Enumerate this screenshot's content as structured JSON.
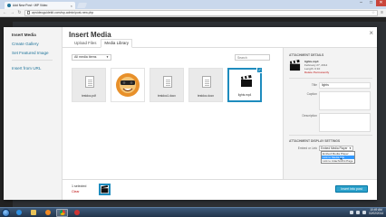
{
  "browser": {
    "tab_title": "Add New Post ‹ WP Video",
    "url": "wpvideoguidekit.com/wp-admin/post-new.php",
    "new_tab_label": "",
    "window_controls": [
      "–",
      "□",
      "✕"
    ]
  },
  "modal": {
    "title": "Insert Media",
    "close_label": "×",
    "menu": {
      "active": "Insert Media",
      "items": [
        "Create Gallery",
        "Set Featured Image"
      ],
      "url_item": "Insert from URL"
    },
    "router": {
      "tabs": [
        "Upload Files",
        "Media Library"
      ],
      "active_index": 1
    },
    "filter": {
      "selected": "All media items",
      "search_placeholder": "Search"
    },
    "attachments": [
      {
        "filename": "testdoc.pdf",
        "type": "document"
      },
      {
        "filename": "",
        "type": "image"
      },
      {
        "filename": "testdoc1.docx",
        "type": "document"
      },
      {
        "filename": "testdoc.docx",
        "type": "document"
      },
      {
        "filename": "lights.mp4",
        "type": "video",
        "selected": true
      }
    ],
    "details": {
      "heading": "ATTACHMENT DETAILS",
      "filename": "lights.mp4",
      "date": "February 27, 2014",
      "length": "Length: 0:10",
      "delete_label": "Delete Permanently",
      "fields": {
        "title_label": "Title",
        "title_value": "lights",
        "caption_label": "Caption",
        "caption_value": "",
        "description_label": "Description",
        "description_value": ""
      }
    },
    "display_settings": {
      "heading": "ATTACHMENT DISPLAY SETTINGS",
      "embed_label": "Embed or Link",
      "selected": "Embed Media Player",
      "options": [
        "Embed Media Player",
        "Link to Media File",
        "Link to Attachment Page"
      ],
      "highlighted_index": 1
    },
    "footer": {
      "selected_count": "1 selected",
      "clear_label": "Clear",
      "insert_label": "Insert into post"
    }
  },
  "taskbar": {
    "time": "10:49 AM",
    "date": "02/02/2014"
  },
  "colors": {
    "wp_blue": "#21759b",
    "button_blue": "#2ea2cc",
    "selection_blue": "#1e8cbe",
    "delete_red": "#bc0b0b"
  }
}
